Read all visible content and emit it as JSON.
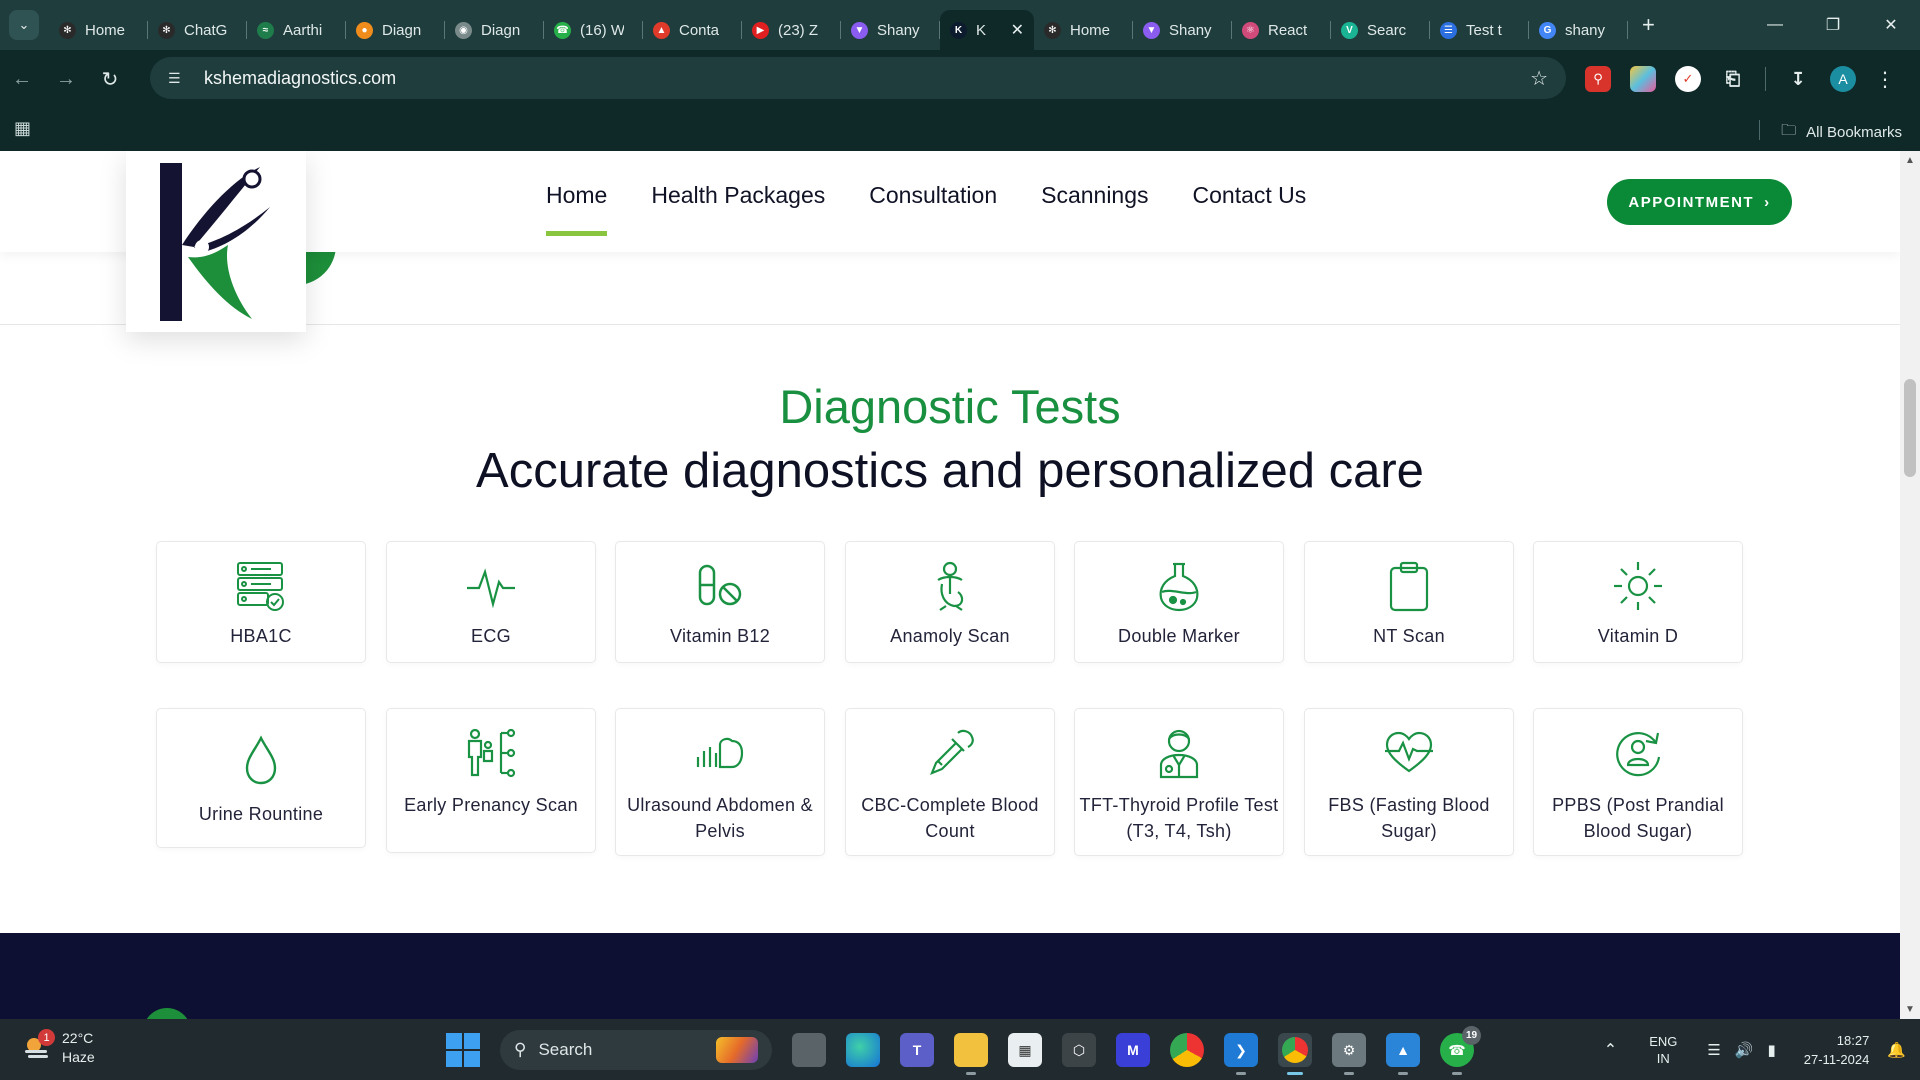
{
  "browser": {
    "tabs": [
      {
        "label": "Home",
        "icon": "openai-icon",
        "color": "#2a2a2a"
      },
      {
        "label": "ChatG",
        "icon": "openai-icon",
        "color": "#2a2a2a"
      },
      {
        "label": "Aarthi",
        "icon": "wave-icon",
        "color": "#1e7d4a"
      },
      {
        "label": "Diagn",
        "icon": "orange-circle-icon",
        "color": "#f08c1c"
      },
      {
        "label": "Diagn",
        "icon": "globe-icon",
        "color": "#7a8a8a"
      },
      {
        "label": "(16) W",
        "icon": "whatsapp-icon",
        "color": "#27b04a"
      },
      {
        "label": "Conta",
        "icon": "flame-icon",
        "color": "#e03a2a"
      },
      {
        "label": "(23) Z",
        "icon": "youtube-icon",
        "color": "#e02020"
      },
      {
        "label": "Shany",
        "icon": "vite-icon",
        "color": "#8a5cf0"
      },
      {
        "label": "K",
        "icon": "kshema-icon",
        "color": "#0d1b2e",
        "active": true
      },
      {
        "label": "Home",
        "icon": "openai-icon",
        "color": "#2a2a2a"
      },
      {
        "label": "Shany",
        "icon": "vite-icon",
        "color": "#8a5cf0"
      },
      {
        "label": "React",
        "icon": "react-icon",
        "color": "#d04a7a"
      },
      {
        "label": "Searc",
        "icon": "vuetify-icon",
        "color": "#1ab394"
      },
      {
        "label": "Test t",
        "icon": "forms-icon",
        "color": "#2b6fe0"
      },
      {
        "label": "shany",
        "icon": "google-icon",
        "color": "#4285f4"
      }
    ],
    "url": "kshemadiagnostics.com",
    "all_bookmarks": "All Bookmarks"
  },
  "site": {
    "nav": [
      {
        "label": "Home",
        "active": true
      },
      {
        "label": "Health Packages",
        "active": false
      },
      {
        "label": "Consultation",
        "active": false
      },
      {
        "label": "Scannings",
        "active": false
      },
      {
        "label": "Contact Us",
        "active": false
      }
    ],
    "appointment_label": "APPOINTMENT",
    "appointment_arrow": "›",
    "colors": {
      "brand_green": "#0a8a36",
      "navy": "#0e1033",
      "accent_lime": "#8ac53f"
    }
  },
  "section": {
    "kicker": "Diagnostic Tests",
    "title": "Accurate diagnostics and personalized care",
    "tests": [
      {
        "label": "HBA1C",
        "icon": "server-check-icon"
      },
      {
        "label": "ECG",
        "icon": "pulse-icon"
      },
      {
        "label": "Vitamin B12",
        "icon": "pill-icon"
      },
      {
        "label": "Anamoly Scan",
        "icon": "fetus-icon"
      },
      {
        "label": "Double Marker",
        "icon": "flask-icon"
      },
      {
        "label": "NT Scan",
        "icon": "clipboard-icon"
      },
      {
        "label": "Vitamin D",
        "icon": "sun-icon"
      },
      {
        "label": "Urine Rountine",
        "icon": "droplet-icon"
      },
      {
        "label": "Early Prenancy Scan",
        "icon": "family-tree-icon"
      },
      {
        "label": "Ulrasound Abdomen & Pelvis",
        "icon": "ultrasound-icon"
      },
      {
        "label": "CBC-Complete Blood Count",
        "icon": "dropper-icon"
      },
      {
        "label": "TFT-Thyroid Profile Test (T3, T4, Tsh)",
        "icon": "doctor-icon"
      },
      {
        "label": "FBS (Fasting Blood Sugar)",
        "icon": "heartbeat-icon"
      },
      {
        "label": "PPBS (Post Prandial Blood Sugar)",
        "icon": "user-refresh-icon"
      }
    ]
  },
  "taskbar": {
    "weather_temp": "22°C",
    "weather_desc": "Haze",
    "weather_badge": "1",
    "search_label": "Search",
    "whatsapp_badge": "19",
    "lang_top": "ENG",
    "lang_bottom": "IN",
    "time": "18:27",
    "date": "27-11-2024"
  }
}
